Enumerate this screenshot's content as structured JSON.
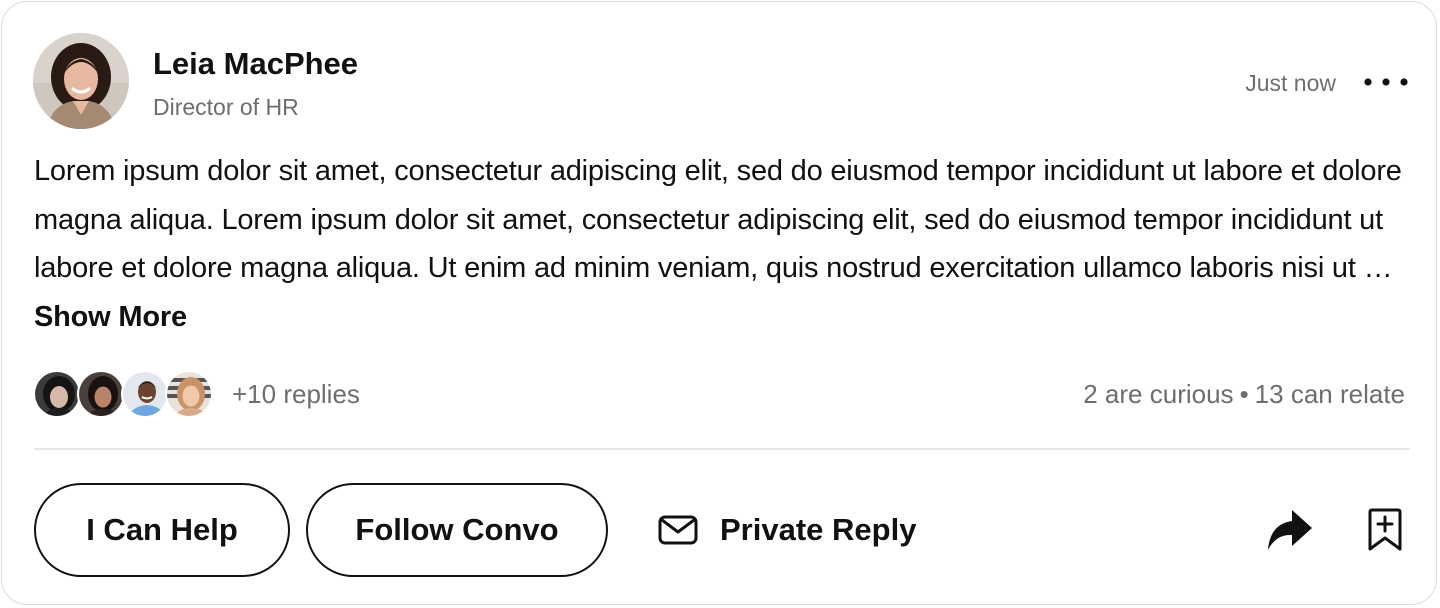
{
  "post": {
    "author": {
      "name": "Leia MacPhee",
      "role": "Director of HR",
      "avatar": "profile-photo"
    },
    "timestamp": "Just now",
    "menu_icon": "more-horizontal-icon",
    "body": "Lorem ipsum dolor sit amet, consectetur adipiscing elit, sed do eiusmod tempor incididunt ut labore et dolore magna aliqua. Lorem ipsum dolor sit amet, consectetur adipiscing elit, sed do eiusmod tempor incididunt ut labore et dolore magna aliqua. Ut enim ad minim veniam, quis nostrud exercitation ullamco laboris nisi ut … ",
    "show_more_label": "Show More"
  },
  "replies": {
    "avatars": [
      "replier-1",
      "replier-2",
      "replier-3",
      "replier-4"
    ],
    "count_label": "+10 replies"
  },
  "reactions": {
    "curious": "2 are curious",
    "separator": "•",
    "relate": "13 can relate"
  },
  "actions": {
    "help_label": "I Can Help",
    "follow_label": "Follow Convo",
    "private_reply_label": "Private Reply",
    "private_reply_icon": "mail-icon",
    "share_icon": "share-icon",
    "bookmark_icon": "bookmark-add-icon"
  },
  "colors": {
    "text_primary": "#111111",
    "text_secondary": "#6e6e6e",
    "divider": "#e6e6e6",
    "card_border": "#dcdcdc"
  }
}
